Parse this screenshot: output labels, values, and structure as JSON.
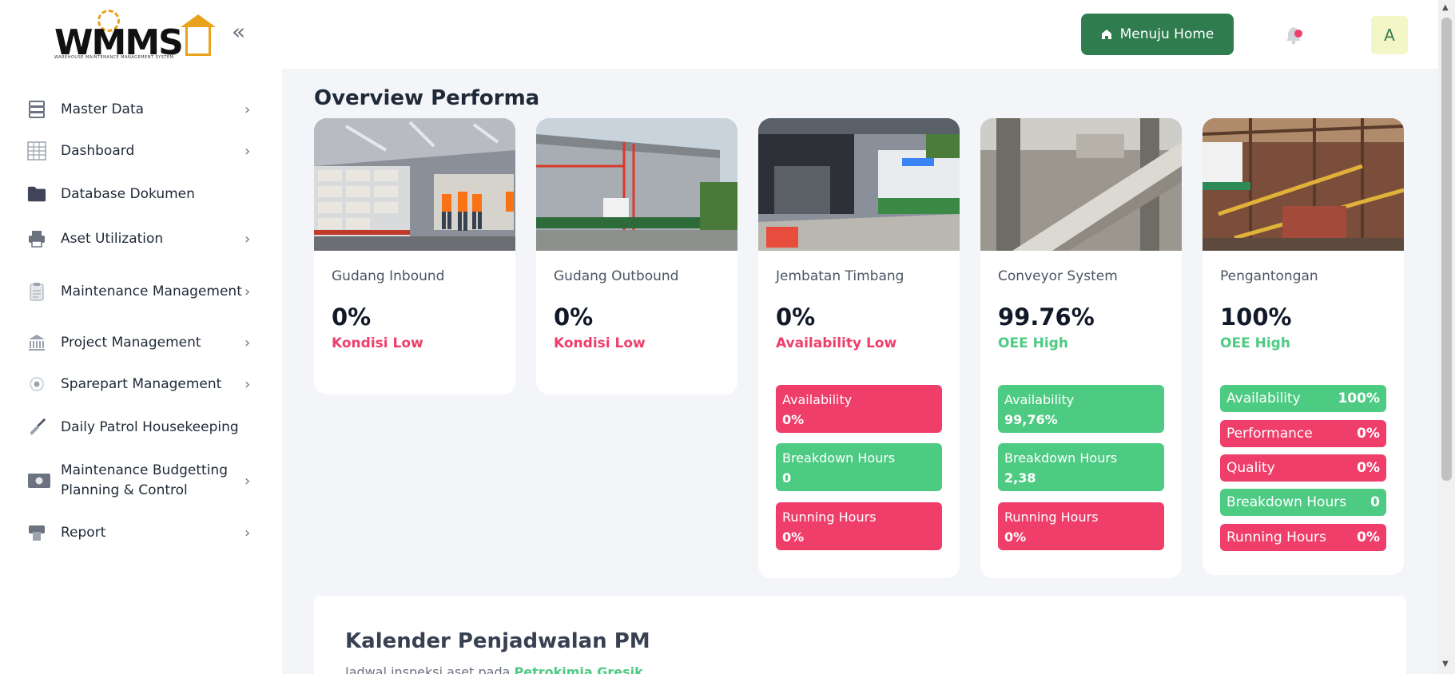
{
  "logo": {
    "text": "WMMS",
    "subtitle": "WAREHOUSE MAINTENANCE MANAGEMENT SYSTEM"
  },
  "sidebar": {
    "collapse_icon": "double-chevron-left-icon",
    "items": [
      {
        "label": "Master Data",
        "icon": "server-icon",
        "has_chevron": true
      },
      {
        "label": "Dashboard",
        "icon": "table-icon",
        "has_chevron": true
      },
      {
        "label": "Database Dokumen",
        "icon": "folder-icon",
        "has_chevron": false
      },
      {
        "label": "Aset Utilization",
        "icon": "printer-icon",
        "has_chevron": true
      },
      {
        "label": "Maintenance Management",
        "icon": "clipboard-icon",
        "has_chevron": true
      },
      {
        "label": "Project Management",
        "icon": "bank-icon",
        "has_chevron": true
      },
      {
        "label": "Sparepart Management",
        "icon": "target-icon",
        "has_chevron": true
      },
      {
        "label": "Daily Patrol Housekeeping",
        "icon": "broom-icon",
        "has_chevron": false
      },
      {
        "label": "Maintenance Budgetting Planning & Control",
        "icon": "money-icon",
        "has_chevron": true
      },
      {
        "label": "Report",
        "icon": "print-icon",
        "has_chevron": true
      }
    ]
  },
  "header": {
    "home_button": "Menuju Home",
    "avatar_initial": "A"
  },
  "main": {
    "title": "Overview Performa",
    "cards": [
      {
        "name": "Gudang Inbound",
        "value": "0%",
        "status": "Kondisi Low",
        "status_color": "red",
        "metrics": []
      },
      {
        "name": "Gudang Outbound",
        "value": "0%",
        "status": "Kondisi Low",
        "status_color": "red",
        "metrics": []
      },
      {
        "name": "Jembatan Timbang",
        "value": "0%",
        "status": "Availability Low",
        "status_color": "red",
        "metrics": [
          {
            "label": "Availability",
            "value": "0%",
            "color": "red"
          },
          {
            "label": "Breakdown Hours",
            "value": "0",
            "color": "green"
          },
          {
            "label": "Running Hours",
            "value": "0%",
            "color": "red"
          }
        ]
      },
      {
        "name": "Conveyor System",
        "value": "99.76%",
        "status": "OEE High",
        "status_color": "green",
        "metrics": [
          {
            "label": "Availability",
            "value": "99,76%",
            "color": "green"
          },
          {
            "label": "Breakdown Hours",
            "value": "2,38",
            "color": "green"
          },
          {
            "label": "Running Hours",
            "value": "0%",
            "color": "red"
          }
        ]
      },
      {
        "name": "Pengantongan",
        "value": "100%",
        "status": "OEE High",
        "status_color": "green",
        "metrics": [
          {
            "label": "Availability",
            "value": "100%",
            "color": "green"
          },
          {
            "label": "Performance",
            "value": "0%",
            "color": "red"
          },
          {
            "label": "Quality",
            "value": "0%",
            "color": "red"
          },
          {
            "label": "Breakdown Hours",
            "value": "0",
            "color": "green"
          },
          {
            "label": "Running Hours",
            "value": "0%",
            "color": "red"
          }
        ]
      }
    ],
    "calendar": {
      "title": "Kalender Penjadwalan PM",
      "subtitle_prefix": "Jadwal inspeksi aset pada",
      "subtitle_highlight": "Petrokimia Gresik"
    }
  },
  "colors": {
    "red": "#ef3e6a",
    "green": "#4ecb83",
    "primary": "#2f7d4f"
  }
}
